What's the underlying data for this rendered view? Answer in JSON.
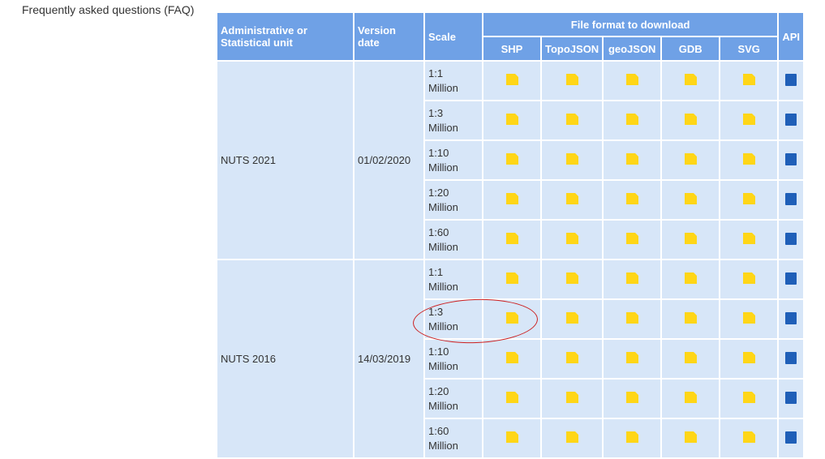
{
  "faq_link": "Frequently asked questions (FAQ)",
  "table": {
    "headers": {
      "unit": "Administrative or Statistical unit",
      "version_date": "Version date",
      "scale": "Scale",
      "file_format_group": "File format to download",
      "api": "API",
      "formats": [
        "SHP",
        "TopoJSON",
        "geoJSON",
        "GDB",
        "SVG"
      ]
    },
    "icon_labels": {
      "zip": "ZIP",
      "api": "</>"
    },
    "groups": [
      {
        "unit": "NUTS 2021",
        "version_date": "01/02/2020",
        "scales": [
          {
            "ratio": "1:1",
            "unit": "Million"
          },
          {
            "ratio": "1:3",
            "unit": "Million"
          },
          {
            "ratio": "1:10",
            "unit": "Million"
          },
          {
            "ratio": "1:20",
            "unit": "Million"
          },
          {
            "ratio": "1:60",
            "unit": "Million"
          }
        ]
      },
      {
        "unit": "NUTS 2016",
        "version_date": "14/03/2019",
        "scales": [
          {
            "ratio": "1:1",
            "unit": "Million"
          },
          {
            "ratio": "1:3",
            "unit": "Million"
          },
          {
            "ratio": "1:10",
            "unit": "Million"
          },
          {
            "ratio": "1:20",
            "unit": "Million"
          },
          {
            "ratio": "1:60",
            "unit": "Million"
          }
        ]
      }
    ]
  },
  "annotation": {
    "circled_row": "NUTS 2016 1:3 Million",
    "color": "#cc1f1f"
  },
  "colors": {
    "header_bg": "#6fa1e6",
    "cell_bg": "#d7e6f8",
    "zip_icon": "#ffd617",
    "api_icon": "#1f5fb8"
  }
}
